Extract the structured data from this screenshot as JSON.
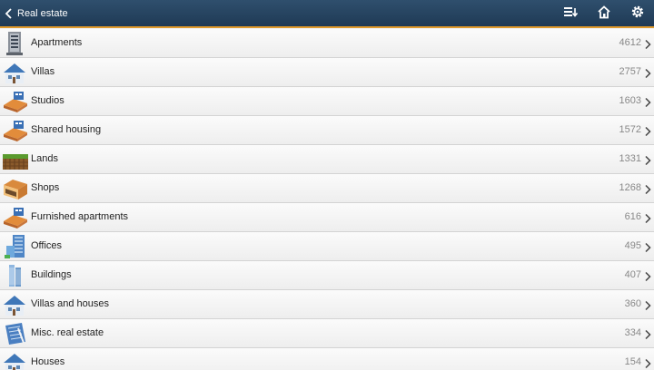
{
  "header": {
    "title": "Real estate"
  },
  "colors": {
    "header_bg": "#244563",
    "header_accent": "#e09a2c",
    "count_text": "#888888"
  },
  "items": [
    {
      "label": "Apartments",
      "count": "4612",
      "icon": "apartment-building-icon"
    },
    {
      "label": "Villas",
      "count": "2757",
      "icon": "villa-icon"
    },
    {
      "label": "Studios",
      "count": "1603",
      "icon": "studio-icon"
    },
    {
      "label": "Shared housing",
      "count": "1572",
      "icon": "shared-housing-icon"
    },
    {
      "label": "Lands",
      "count": "1331",
      "icon": "land-icon"
    },
    {
      "label": "Shops",
      "count": "1268",
      "icon": "shop-icon"
    },
    {
      "label": "Furnished apartments",
      "count": "616",
      "icon": "furnished-apartment-icon"
    },
    {
      "label": "Offices",
      "count": "495",
      "icon": "office-building-icon"
    },
    {
      "label": "Buildings",
      "count": "407",
      "icon": "buildings-icon"
    },
    {
      "label": "Villas and houses",
      "count": "360",
      "icon": "house-icon"
    },
    {
      "label": "Misc. real estate",
      "count": "334",
      "icon": "blueprint-icon"
    },
    {
      "label": "Houses",
      "count": "154",
      "icon": "house-icon"
    }
  ]
}
